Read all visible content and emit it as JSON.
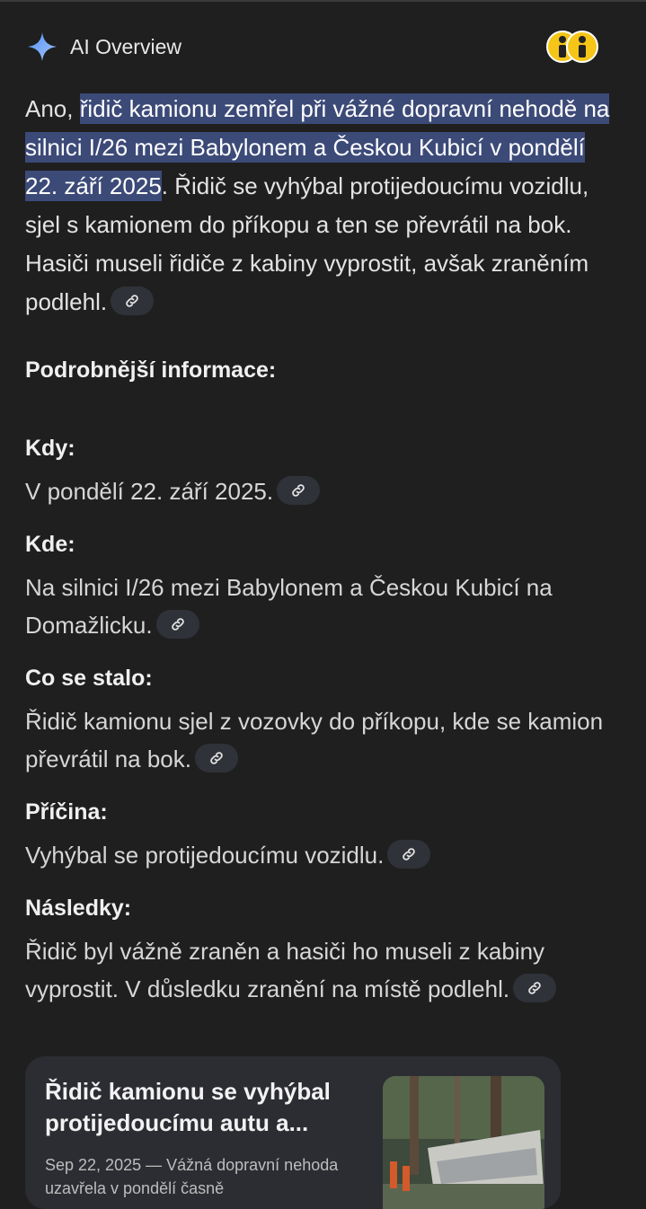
{
  "header": {
    "title": "AI Overview",
    "icon": "sparkle-icon",
    "accent": "#8ab4f8"
  },
  "intro": {
    "prefix": "Ano, ",
    "highlight": "řidič kamionu zemřel při vážné dopravní nehodě na silnici I/26 mezi Babylonem a Českou Kubicí v pondělí 22. září 2025",
    "rest": ". Řidič se vyhýbal protijedoucímu vozidlu, sjel s kamionem do příkopu a ten se převrátil na bok. Hasiči museli řidiče z kabiny vyprostit, avšak zraněním podlehl."
  },
  "details_heading": "Podrobnější informace:",
  "sections": [
    {
      "title": "Kdy:",
      "body": "V pondělí 22. září 2025."
    },
    {
      "title": "Kde:",
      "body": "Na silnici I/26 mezi Babylonem a Českou Kubicí na Domažlicku."
    },
    {
      "title": "Co se stalo:",
      "body": "Řidič kamionu sjel z vozovky do příkopu, kde se kamion převrátil na bok."
    },
    {
      "title": "Příčina:",
      "body": "Vyhýbal se protijedoucímu vozidlu."
    },
    {
      "title": "Následky:",
      "body": "Řidič byl vážně zraněn a hasiči ho museli z kabiny vyprostit. V důsledku zranění na místě podlehl."
    }
  ],
  "source_card": {
    "title": "Řidič kamionu se vyhýbal protijedoucímu autu a...",
    "snippet": "Sep 22, 2025 — Vážná dopravní nehoda uzavřela v pondělí časně"
  },
  "colors": {
    "background": "#1f1f1f",
    "highlight": "#3c4a78",
    "chip": "#303239",
    "card": "#2c2d33"
  }
}
